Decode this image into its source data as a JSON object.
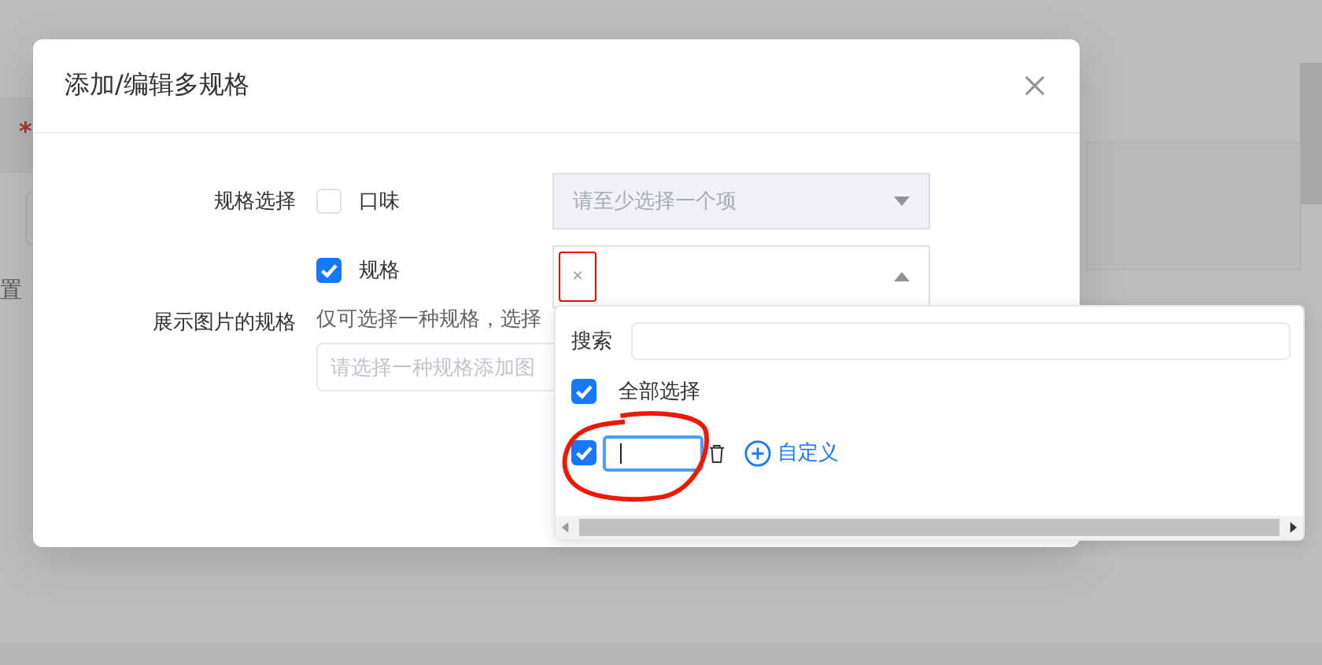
{
  "background": {
    "required_mark": "*",
    "text": "置"
  },
  "dialog": {
    "title": "添加/编辑多规格"
  },
  "spec_select": {
    "label": "规格选择",
    "options": [
      {
        "label": "口味",
        "checked": false,
        "select": {
          "placeholder": "请至少选择一个项",
          "disabled": true,
          "open": false
        }
      },
      {
        "label": "规格",
        "checked": true,
        "select": {
          "disabled": false,
          "open": true,
          "tags": [
            {
              "remove": "×"
            }
          ]
        }
      }
    ]
  },
  "image_spec": {
    "label": "展示图片的规格",
    "hint": "仅可选择一种规格，选择",
    "placeholder": "请选择一种规格添加图"
  },
  "dropdown": {
    "search_label": "搜索",
    "select_all": {
      "label": "全部选择",
      "checked": true
    },
    "items": [
      {
        "checked": true,
        "focused": true
      }
    ],
    "add_label": "自定义"
  }
}
